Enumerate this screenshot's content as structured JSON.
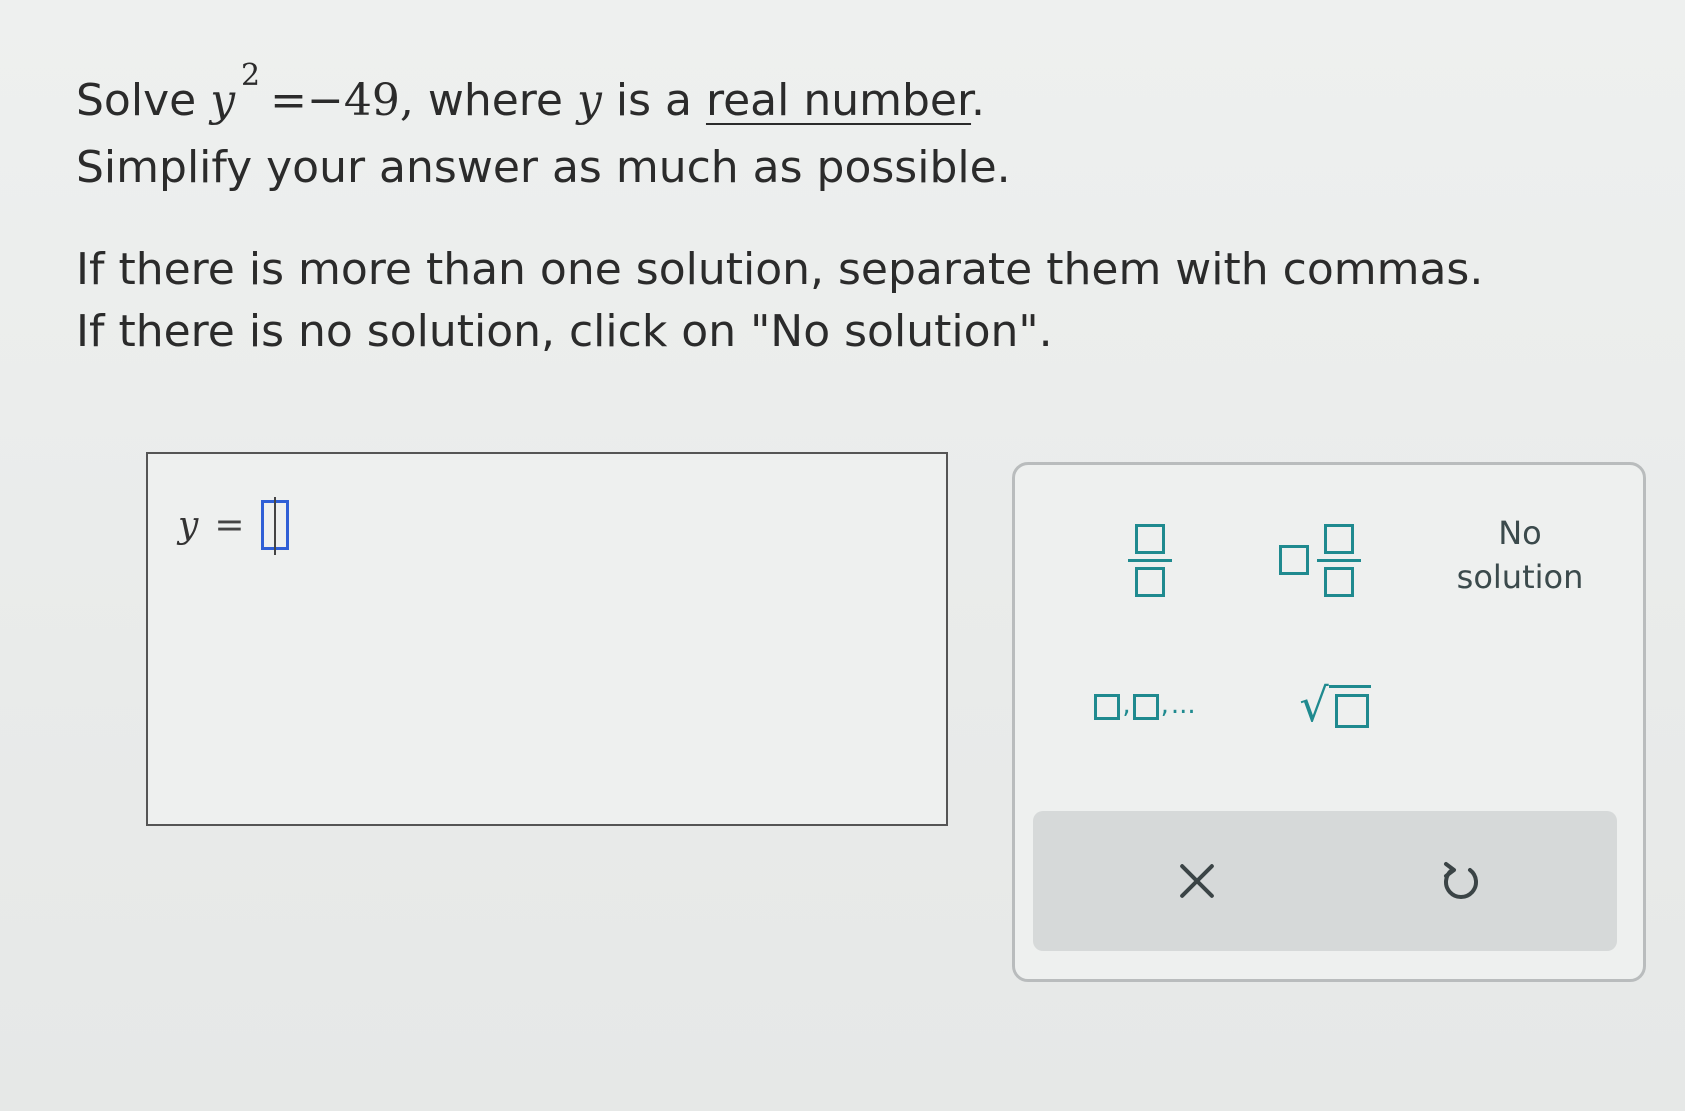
{
  "question": {
    "solve_prefix": "Solve",
    "var": "y",
    "exponent": "2",
    "equation_rest": "=−49,",
    "where_text": "where",
    "where_var": "y",
    "is_a": "is a",
    "link_text": "real number",
    "period": ".",
    "line2": "Simplify your answer as much as possible.",
    "line3": "If there is more than one solution, separate them with commas.",
    "line4": "If there is no solution, click on \"No solution\"."
  },
  "answer": {
    "variable": "y",
    "equals": "=",
    "value": ""
  },
  "keypad": {
    "no_solution_line1": "No",
    "no_solution_line2": "solution",
    "list_ellipsis": "...",
    "accent_color": "#1f8a8f",
    "icons": [
      "fraction-icon",
      "mixed-number-icon",
      "list-icon",
      "square-root-icon",
      "clear-icon",
      "undo-icon"
    ]
  }
}
